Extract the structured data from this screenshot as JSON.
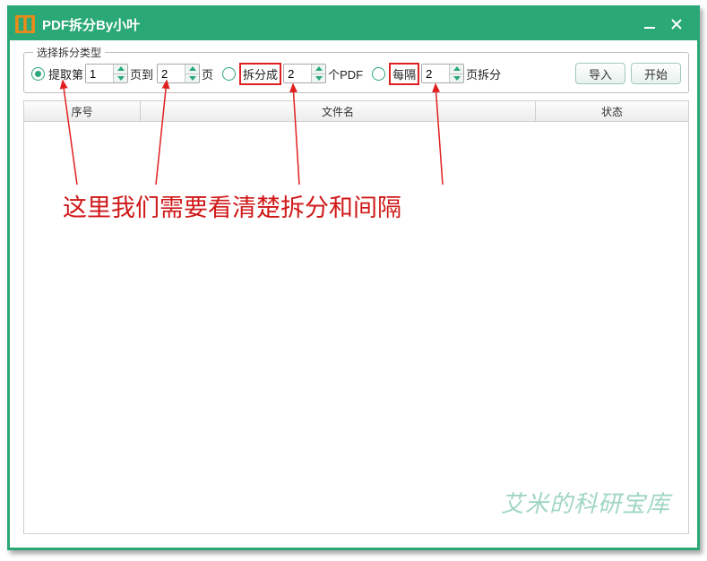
{
  "titlebar": {
    "title": "PDF拆分By小叶"
  },
  "groupbox": {
    "title": "选择拆分类型"
  },
  "options": {
    "opt1_label": "提取第",
    "opt1_value1": "1",
    "opt1_mid": "页到",
    "opt1_value2": "2",
    "opt1_tail": "页",
    "opt2_label": "拆分成",
    "opt2_value": "2",
    "opt2_tail": "个PDF",
    "opt3_label": "每隔",
    "opt3_value": "2",
    "opt3_tail": "页拆分"
  },
  "buttons": {
    "import": "导入",
    "start": "开始"
  },
  "table": {
    "col1": "序号",
    "col2": "文件名",
    "col3": "状态"
  },
  "watermark": "艾米的科研宝库",
  "annotation": "这里我们需要看清楚拆分和间隔"
}
